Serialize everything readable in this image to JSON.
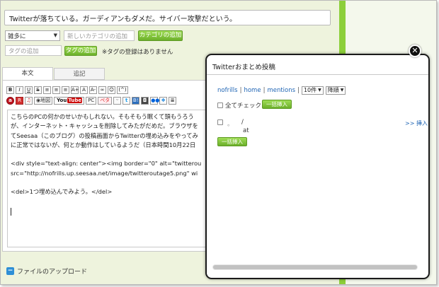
{
  "editor_form": {
    "title_value": "Twitterが落ちている。ガーディアンもダメだ。サイバー攻撃だという。",
    "category_selected": "雑多に",
    "new_category_placeholder": "新しいカテゴリの追加",
    "add_category_label": "カテゴリの追加",
    "tag_placeholder": "タグの追加",
    "add_tag_label": "タグの追加",
    "tag_note": "※タグの登録はありません"
  },
  "tabs": [
    {
      "label": "本文"
    },
    {
      "label": "追記"
    }
  ],
  "toolbar": {
    "row1": [
      "B",
      "I",
      "U",
      "S",
      "≡",
      "≡",
      "≡",
      "A+",
      "A",
      "A-",
      "∞",
      "☺",
      "(^)"
    ],
    "row2": {
      "amazon": "a",
      "rakuten": "R",
      "music": "♫",
      "map": "地図",
      "youtube_a": "You",
      "youtube_b": "Tube",
      "pc": "PC",
      "peta": "ペタ",
      "emoji": "ᵕ",
      "twitter": "t",
      "hatena": "B!",
      "instagram": "◘",
      "flickr": "●●",
      "dropbox": "❖",
      "list": "≣"
    }
  },
  "editor_text": {
    "lines": [
      "こちらのPCの何かのせいかもしれない。そもそもう眠くて頭もうろう",
      "が、インターネット・キャッシュを削除してみたがだめだ。ブラウザを",
      "てSeesaa（このブログ）の投稿画面からTwitterの埋め込みをやってみ",
      "に正常ではないが、何とか動作はしているようだ（日本時間10月22日",
      "",
      "<div style=\"text-align: center\"><img border=\"0\" alt=\"twitterou",
      "src=\"http://nofrills.up.seesaa.net/image/twitteroutage5.png\" wi",
      "",
      "<del>1つ埋め込んでみよう。</del>"
    ]
  },
  "upload": {
    "icon": "minus-icon",
    "label": "ファイルのアップロード"
  },
  "modal": {
    "close_symbol": "✕",
    "title": "Twitterおまとめ投稿",
    "filter_links": [
      "nofrills",
      "home",
      "mentions"
    ],
    "count_selected": "10件",
    "order_selected": "降順",
    "check_all_label": "全てチェック",
    "bulk_insert_label": "一括挿入",
    "item": {
      "dot": "。",
      "slash": "/",
      "at": "at",
      "insert_label": ">> 挿入"
    }
  }
}
